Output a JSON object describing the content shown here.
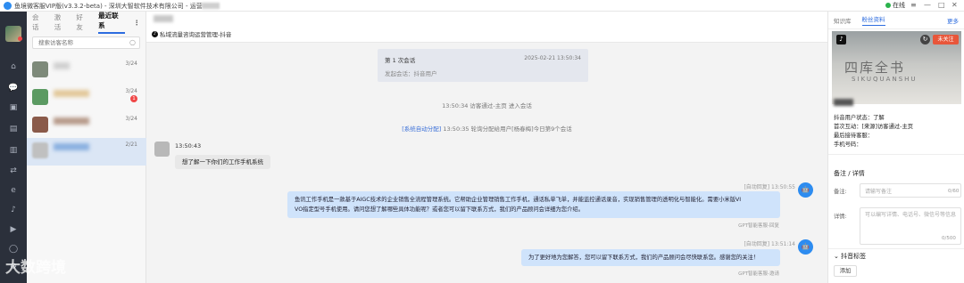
{
  "window": {
    "title": "鱼境微客服VIP版(v3.3.2-beta) - 深圳大智软件技术有限公司 - 运营",
    "status_label": "在线",
    "controls": {
      "menu": "≡",
      "minimize": "—",
      "maximize": "□",
      "close": "✕"
    }
  },
  "sidebar": {
    "icons": [
      "home-icon",
      "chat-icon",
      "contacts-icon",
      "document-icon",
      "folder-icon",
      "share-icon",
      "browser-icon",
      "tiktok-icon",
      "kuaishou-icon",
      "comment-icon",
      "settings-icon"
    ]
  },
  "contacts": {
    "tabs": [
      "会话",
      "激活",
      "好友",
      "最近联系"
    ],
    "active_tab": "最近联系",
    "more": "⋮",
    "search_placeholder": "搜索访客名称",
    "rows": [
      {
        "date": "3/24",
        "badge": ""
      },
      {
        "date": "3/24",
        "badge": "1"
      },
      {
        "date": "3/24",
        "badge": ""
      },
      {
        "date": "2/21",
        "badge": ""
      }
    ]
  },
  "chat": {
    "source": "私域流量咨询运营管理-抖音",
    "session": {
      "title": "第 1 次会话",
      "time": "2025-02-21 13:50:34",
      "initiator": "发起会话：抖音用户"
    },
    "system": [
      {
        "text": "13:50:34 访客通过-主页 进入会话"
      },
      {
        "link": "[系统自动分配]",
        "text": "13:50:35 轮询分配给用户[杨春梅]今日第9个会话"
      }
    ],
    "customer": {
      "time": "13:50:43",
      "text": "想了解一下你们的工作手机系统"
    },
    "bot_messages": [
      {
        "meta": "[自动回复] 13:50:55",
        "lines": [
          "鱼讯工作手机是一款基于AIGC技术的企业销售全流程管理系统。它帮助企业管理销售工作手机，通话私单飞单，并能监控通话录音，实现销售管理的透明化与智能化。需要小米版VI",
          "VO指定型号手机使用。请问您想了解哪些具体功能呢？或者您可以留下联系方式，我们的产品顾问会详细为您介绍。"
        ],
        "footer": "GPT智能客服-回复",
        "avatar": "🤖"
      },
      {
        "meta": "[自动回复] 13:51:14",
        "lines": [
          "为了更好地为您解答，您可以留下联系方式，我们的产品顾问会尽快联系您。感谢您的关注！"
        ],
        "footer": "GPT智能客服-邀请",
        "avatar": "🤖"
      }
    ]
  },
  "profile": {
    "tabs": [
      "知识库",
      "粉丝资料"
    ],
    "active_tab": "粉丝资料",
    "more": "更多",
    "cover_text": "四库全书",
    "cover_subtext": "SIKUQUANSHU",
    "unfollow": "未关注",
    "fields": [
      "抖音用户状态：了解",
      "首次互动：[来源]访客通过-主页",
      "最后接待客服：",
      "手机号码："
    ],
    "notes_title": "备注 / 详情",
    "note_label": "备注:",
    "note_placeholder": "请输写备注",
    "note_count": "0/60",
    "detail_label": "详情:",
    "detail_placeholder": "可以编写详情、电话号、微信号等信息",
    "detail_count": "0/500",
    "tags_title": "抖音标签",
    "add_label": "添加"
  },
  "watermark": "大数跨境"
}
